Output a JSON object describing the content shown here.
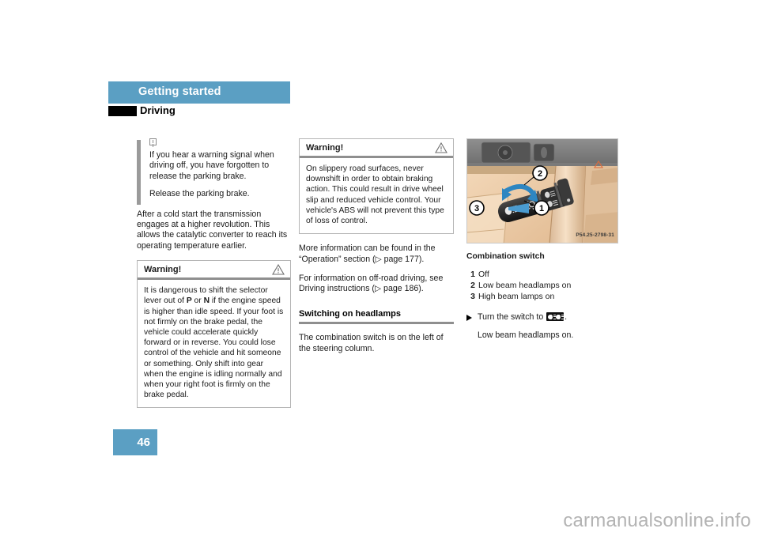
{
  "document": {
    "page_number": "46",
    "watermark": "carmanualsonline.info"
  },
  "header": {
    "chapter_title": "Getting started",
    "section_title": "Driving",
    "bar_color": "#5b9fc3"
  },
  "column1": {
    "note": {
      "icon": "exclamation-box-icon",
      "paragraphs": [
        "If you hear a warning signal when driving off, you have forgotten to release the parking brake.",
        "Release the parking brake."
      ]
    },
    "body_text": "After a cold start the transmission engages at a higher revolution. This allows the catalytic converter to reach its operating temperature earlier.",
    "warning": {
      "title": "Warning!",
      "icon": "warning-triangle-icon",
      "text_parts": [
        "It is dangerous to shift the selector lever out of ",
        "P",
        " or ",
        "N",
        " if the engine speed is higher than idle speed. If your foot is not firmly on the brake pedal, the vehicle could accelerate quickly forward or in reverse. You could lose control of the vehicle and hit someone or something. Only shift into gear when the engine is idling normally and when your right foot is firmly on the brake pedal."
      ]
    }
  },
  "column2": {
    "warning": {
      "title": "Warning!",
      "icon": "warning-triangle-icon",
      "text": "On slippery road surfaces, never downshift in order to obtain braking action. This could result in drive wheel slip and reduced vehicle control. Your vehicle's ABS will not prevent this type of loss of control."
    },
    "paragraph1_prefix": "More information can be found in the “Operation” section (",
    "paragraph1_ref": "▷ page 177",
    "paragraph1_suffix": ").",
    "paragraph2_prefix": "For information on off-road driving, see Driving instructions (",
    "paragraph2_ref": "▷ page 186",
    "paragraph2_suffix": ").",
    "section_heading": "Switching on headlamps",
    "paragraph3": "The combination switch is on the left of the steering column."
  },
  "column3": {
    "figure": {
      "id_label": "P54.25-2798-31",
      "callouts": [
        "1",
        "2",
        "3"
      ],
      "alt": "combination-switch-photo"
    },
    "caption": "Combination switch",
    "legend": [
      {
        "num": "1",
        "label": "Off"
      },
      {
        "num": "2",
        "label": "Low beam headlamps on"
      },
      {
        "num": "3",
        "label": "High beam lamps on"
      }
    ],
    "action": {
      "arrow": "action-arrow-icon",
      "text_before": "Turn the switch to ",
      "glyph": "low-beam-headlamp-symbol",
      "text_after": "."
    },
    "action_result": "Low beam headlamps on."
  }
}
